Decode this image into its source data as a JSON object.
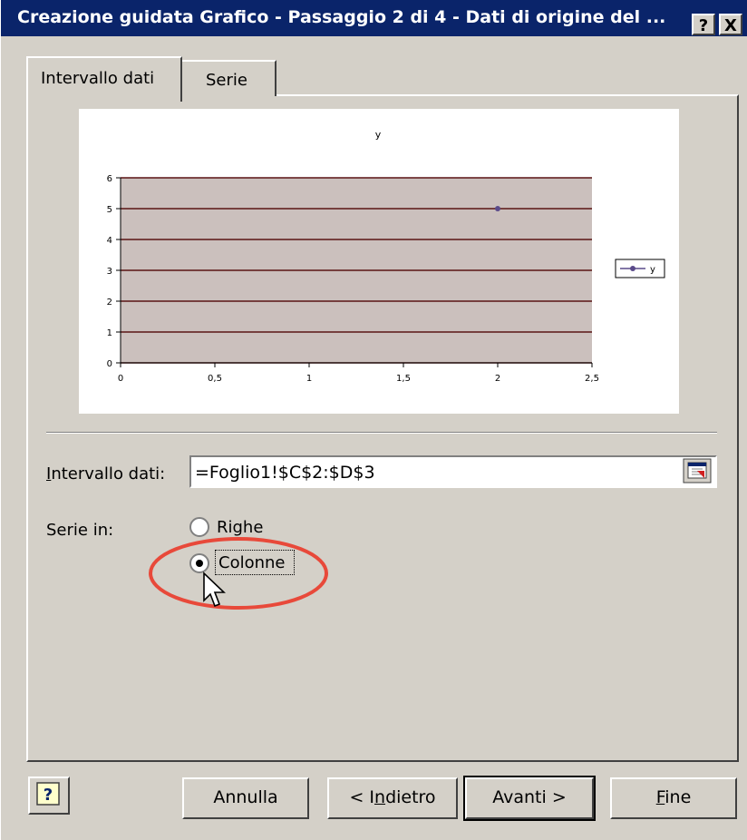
{
  "window": {
    "title": "Creazione guidata Grafico - Passaggio 2 di 4 - Dati di origine del ...",
    "help_button": "?",
    "close_button": "X"
  },
  "tabs": [
    {
      "label": "Intervallo dati",
      "active": true
    },
    {
      "label": "Serie",
      "active": false
    }
  ],
  "chart_data": {
    "type": "line",
    "title": "y",
    "x_ticks": [
      "0",
      "0,5",
      "1",
      "1,5",
      "2",
      "2,5"
    ],
    "y_ticks": [
      "0",
      "1",
      "2",
      "3",
      "4",
      "5",
      "6"
    ],
    "xlim": [
      0,
      2.5
    ],
    "ylim": [
      0,
      6
    ],
    "series": [
      {
        "name": "y",
        "points": [
          {
            "x": 2,
            "y": 5
          }
        ]
      }
    ],
    "legend": "right",
    "grid": true,
    "plot_bg": "#cbc0bd",
    "gridline_color": "#5a1414",
    "series_color": "#5a4a8a"
  },
  "data_range": {
    "label": "Intervallo dati:",
    "value": "=Foglio1!$C$2:$D$3"
  },
  "series_in": {
    "label": "Serie in:",
    "options": [
      {
        "label": "Righe",
        "selected": false
      },
      {
        "label": "Colonne",
        "selected": true
      }
    ]
  },
  "buttons": {
    "cancel": "Annulla",
    "back": "< Indietro",
    "next": "Avanti >",
    "finish": "Fine"
  },
  "colors": {
    "title_bar": "#0a246a",
    "dialog_bg": "#d4d0c8",
    "annotation_ellipse": "#e8493a"
  }
}
